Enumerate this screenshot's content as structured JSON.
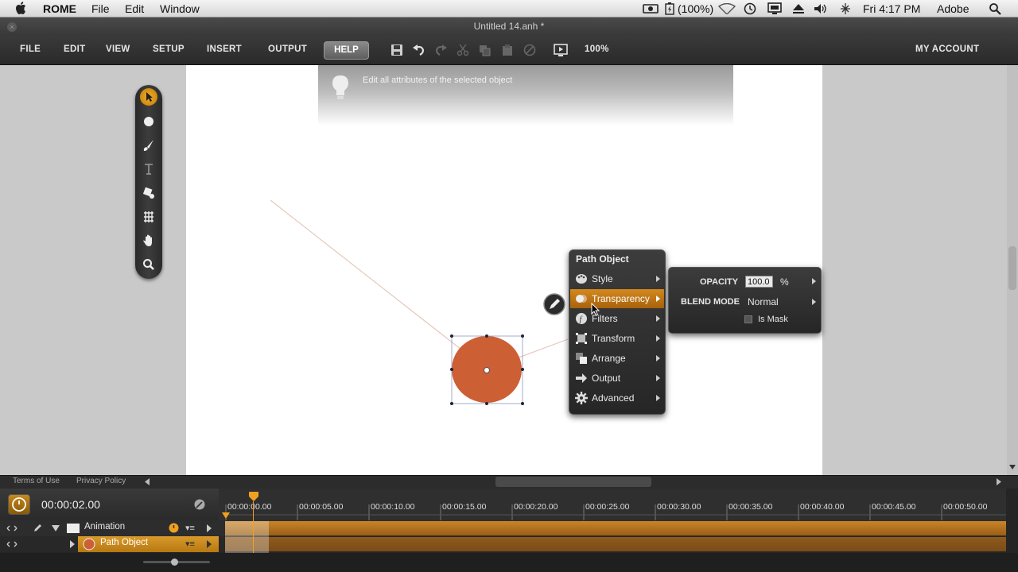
{
  "menubar": {
    "app_name": "ROME",
    "items": [
      "File",
      "Edit",
      "Window"
    ],
    "battery": "(100%)",
    "clock": "Fri 4:17 PM",
    "user": "Adobe"
  },
  "window": {
    "title": "Untitled 14.anh *"
  },
  "toolbar": {
    "tabs": [
      "FILE",
      "EDIT",
      "VIEW",
      "SETUP",
      "INSERT",
      "OUTPUT"
    ],
    "help": "HELP",
    "zoom": "100%",
    "account": "MY ACCOUNT"
  },
  "hint": {
    "text": "Edit all attributes of the selected object"
  },
  "context_menu": {
    "title": "Path Object",
    "items": [
      "Style",
      "Transparency",
      "Filters",
      "Transform",
      "Arrange",
      "Output",
      "Advanced"
    ],
    "highlighted": "Transparency"
  },
  "transparency_panel": {
    "opacity_label": "OPACITY",
    "opacity_value": "100.0",
    "opacity_unit": "%",
    "blend_label": "BLEND MODE",
    "blend_value": "Normal",
    "mask_label": "Is Mask"
  },
  "status": {
    "terms": "Terms of Use",
    "privacy": "Privacy Policy"
  },
  "timeline": {
    "timecode": "00:00:02.00",
    "ticks": [
      "00:00:00.00",
      "00:00:05.00",
      "00:00:10.00",
      "00:00:15.00",
      "00:00:20.00",
      "00:00:25.00",
      "00:00:30.00",
      "00:00:35.00",
      "00:00:40.00",
      "00:00:45.00",
      "00:00:50.00"
    ],
    "layers": [
      "Animation",
      "Path Object"
    ]
  },
  "colors": {
    "accent": "#d4891e",
    "shape_fill": "#cd5f35"
  }
}
